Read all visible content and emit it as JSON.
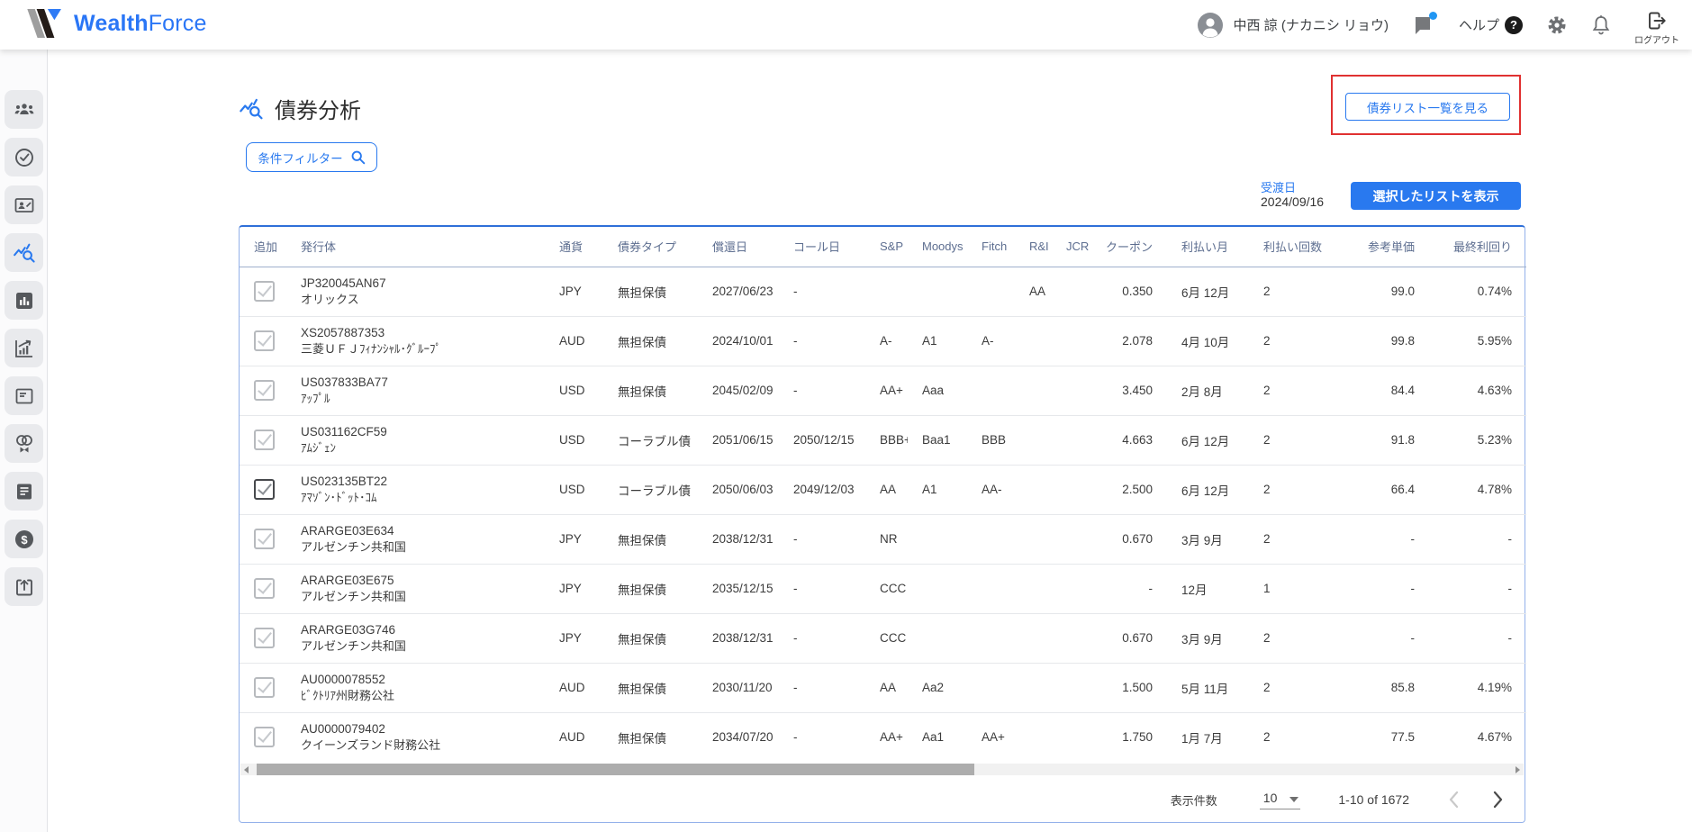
{
  "colors": {
    "accent_blue": "#2979EF",
    "brand_blue": "#2A76F6",
    "annotation_red": "#E03131"
  },
  "header": {
    "brand_wealth": "Wealth",
    "brand_force": "Force",
    "user_name": "中西 諒 (ナカニシ リョウ)",
    "help_label": "ヘルプ",
    "logout_label": "ログアウト"
  },
  "sidebar": {
    "items": [
      {
        "icon": "users-group-icon",
        "active": false
      },
      {
        "icon": "check-circle-icon",
        "active": false
      },
      {
        "icon": "contact-card-icon",
        "active": false
      },
      {
        "icon": "chart-search-icon",
        "active": true
      },
      {
        "icon": "bar-chart-icon",
        "active": false
      },
      {
        "icon": "growth-chart-icon",
        "active": false
      },
      {
        "icon": "document-card-icon",
        "active": false
      },
      {
        "icon": "rings-bowtie-icon",
        "active": false
      },
      {
        "icon": "note-filled-icon",
        "active": false
      },
      {
        "icon": "dollar-circle-icon",
        "active": false
      },
      {
        "icon": "export-box-icon",
        "active": false
      }
    ]
  },
  "page": {
    "title": "債券分析",
    "view_bond_list_button": "債券リスト一覧を見る",
    "filter_button": "条件フィルター",
    "settlement_date_label": "受渡日",
    "settlement_date": "2024/09/16",
    "show_selected_button": "選択したリストを表示"
  },
  "table": {
    "columns": [
      "追加",
      "発行体",
      "通貨",
      "債券タイプ",
      "償還日",
      "コール日",
      "S&P",
      "Moodys",
      "Fitch",
      "R&I",
      "JCR",
      "クーポン",
      "利払い月",
      "利払い回数",
      "参考単価",
      "最終利回り"
    ],
    "rows": [
      {
        "checked": false,
        "code": "JP320045AN67",
        "issuer": "オリックス",
        "currency": "JPY",
        "type": "無担保債",
        "maturity": "2027/06/23",
        "call_date": "-",
        "sp": "",
        "moodys": "",
        "fitch": "",
        "ri": "AA",
        "jcr": "",
        "coupon": "0.350",
        "pay_months": "6月 12月",
        "pay_count": "2",
        "ref_price": "99.0",
        "final_yield": "0.74%"
      },
      {
        "checked": false,
        "code": "XS2057887353",
        "issuer": "三菱ＵＦＪﾌｨﾅﾝｼｬﾙ･ｸﾞﾙｰﾌﾟ",
        "currency": "AUD",
        "type": "無担保債",
        "maturity": "2024/10/01",
        "call_date": "-",
        "sp": "A-",
        "moodys": "A1",
        "fitch": "A-",
        "ri": "",
        "jcr": "",
        "coupon": "2.078",
        "pay_months": "4月 10月",
        "pay_count": "2",
        "ref_price": "99.8",
        "final_yield": "5.95%"
      },
      {
        "checked": false,
        "code": "US037833BA77",
        "issuer": "ｱｯﾌﾟﾙ",
        "currency": "USD",
        "type": "無担保債",
        "maturity": "2045/02/09",
        "call_date": "-",
        "sp": "AA+",
        "moodys": "Aaa",
        "fitch": "",
        "ri": "",
        "jcr": "",
        "coupon": "3.450",
        "pay_months": "2月 8月",
        "pay_count": "2",
        "ref_price": "84.4",
        "final_yield": "4.63%"
      },
      {
        "checked": false,
        "code": "US031162CF59",
        "issuer": "ｱﾑｼﾞｪﾝ",
        "currency": "USD",
        "type": "コーラブル債",
        "maturity": "2051/06/15",
        "call_date": "2050/12/15",
        "sp": "BBB+",
        "moodys": "Baa1",
        "fitch": "BBB",
        "ri": "",
        "jcr": "",
        "coupon": "4.663",
        "pay_months": "6月 12月",
        "pay_count": "2",
        "ref_price": "91.8",
        "final_yield": "5.23%"
      },
      {
        "checked": true,
        "code": "US023135BT22",
        "issuer": "ｱﾏｿﾞﾝ･ﾄﾞｯﾄ･ｺﾑ",
        "currency": "USD",
        "type": "コーラブル債",
        "maturity": "2050/06/03",
        "call_date": "2049/12/03",
        "sp": "AA",
        "moodys": "A1",
        "fitch": "AA-",
        "ri": "",
        "jcr": "",
        "coupon": "2.500",
        "pay_months": "6月 12月",
        "pay_count": "2",
        "ref_price": "66.4",
        "final_yield": "4.78%"
      },
      {
        "checked": false,
        "code": "ARARGE03E634",
        "issuer": "アルゼンチン共和国",
        "currency": "JPY",
        "type": "無担保債",
        "maturity": "2038/12/31",
        "call_date": "-",
        "sp": "NR",
        "moodys": "",
        "fitch": "",
        "ri": "",
        "jcr": "",
        "coupon": "0.670",
        "pay_months": "3月 9月",
        "pay_count": "2",
        "ref_price": "-",
        "final_yield": "-"
      },
      {
        "checked": false,
        "code": "ARARGE03E675",
        "issuer": "アルゼンチン共和国",
        "currency": "JPY",
        "type": "無担保債",
        "maturity": "2035/12/15",
        "call_date": "-",
        "sp": "CCC",
        "moodys": "",
        "fitch": "",
        "ri": "",
        "jcr": "",
        "coupon": "-",
        "pay_months": "12月",
        "pay_count": "1",
        "ref_price": "-",
        "final_yield": "-"
      },
      {
        "checked": false,
        "code": "ARARGE03G746",
        "issuer": "アルゼンチン共和国",
        "currency": "JPY",
        "type": "無担保債",
        "maturity": "2038/12/31",
        "call_date": "-",
        "sp": "CCC",
        "moodys": "",
        "fitch": "",
        "ri": "",
        "jcr": "",
        "coupon": "0.670",
        "pay_months": "3月 9月",
        "pay_count": "2",
        "ref_price": "-",
        "final_yield": "-"
      },
      {
        "checked": false,
        "code": "AU0000078552",
        "issuer": "ﾋﾞｸﾄﾘｱ州財務公社",
        "currency": "AUD",
        "type": "無担保債",
        "maturity": "2030/11/20",
        "call_date": "-",
        "sp": "AA",
        "moodys": "Aa2",
        "fitch": "",
        "ri": "",
        "jcr": "",
        "coupon": "1.500",
        "pay_months": "5月 11月",
        "pay_count": "2",
        "ref_price": "85.8",
        "final_yield": "4.19%"
      },
      {
        "checked": false,
        "code": "AU0000079402",
        "issuer": "クイーンズランド財務公社",
        "currency": "AUD",
        "type": "無担保債",
        "maturity": "2034/07/20",
        "call_date": "-",
        "sp": "AA+",
        "moodys": "Aa1",
        "fitch": "AA+",
        "ri": "",
        "jcr": "",
        "coupon": "1.750",
        "pay_months": "1月 7月",
        "pay_count": "2",
        "ref_price": "77.5",
        "final_yield": "4.67%"
      }
    ]
  },
  "pagination": {
    "rows_per_page_label": "表示件数",
    "rows_per_page": "10",
    "range_text": "1-10 of 1672"
  }
}
